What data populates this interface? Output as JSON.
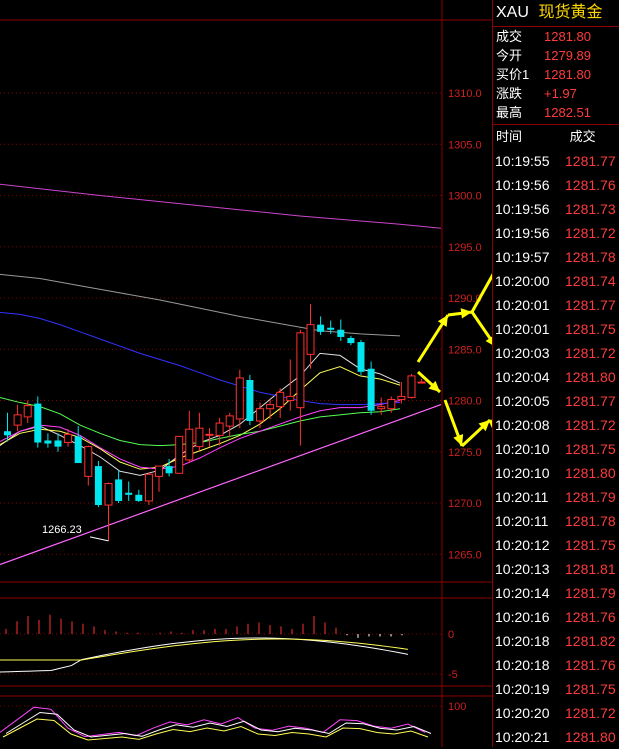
{
  "chart_data": [
    {
      "type": "candlestick",
      "title": "",
      "y_axis_ticks": [
        "1310.0",
        "1305.0",
        "1300.0",
        "1295.0",
        "1290.0",
        "1285.0",
        "1280.0",
        "1275.0",
        "1270.0",
        "1265.0"
      ],
      "ylim": [
        1262.5,
        1313
      ],
      "low_annotation": "1266.23",
      "candles": [
        {
          "o": 1277.0,
          "h": 1278.8,
          "l": 1276.0,
          "c": 1276.6
        },
        {
          "o": 1277.6,
          "h": 1279.6,
          "l": 1277.0,
          "c": 1278.6
        },
        {
          "o": 1278.4,
          "h": 1280.0,
          "l": 1277.8,
          "c": 1279.5
        },
        {
          "o": 1279.7,
          "h": 1280.4,
          "l": 1275.4,
          "c": 1275.9
        },
        {
          "o": 1276.1,
          "h": 1276.8,
          "l": 1275.4,
          "c": 1275.8
        },
        {
          "o": 1276.1,
          "h": 1276.8,
          "l": 1275.0,
          "c": 1275.5
        },
        {
          "o": 1275.9,
          "h": 1277.2,
          "l": 1275.5,
          "c": 1276.7
        },
        {
          "o": 1276.5,
          "h": 1277.5,
          "l": 1273.9,
          "c": 1273.9
        },
        {
          "o": 1272.6,
          "h": 1275.6,
          "l": 1271.7,
          "c": 1275.5
        },
        {
          "o": 1273.6,
          "h": 1274.1,
          "l": 1269.6,
          "c": 1269.8
        },
        {
          "o": 1269.8,
          "h": 1272.0,
          "l": 1266.3,
          "c": 1271.9
        },
        {
          "o": 1272.3,
          "h": 1273.2,
          "l": 1270.0,
          "c": 1270.2
        },
        {
          "o": 1271.0,
          "h": 1272.1,
          "l": 1270.2,
          "c": 1270.8
        },
        {
          "o": 1270.8,
          "h": 1271.3,
          "l": 1270.1,
          "c": 1270.2
        },
        {
          "o": 1270.2,
          "h": 1273.0,
          "l": 1269.8,
          "c": 1272.8
        },
        {
          "o": 1272.6,
          "h": 1273.6,
          "l": 1271.1,
          "c": 1273.6
        },
        {
          "o": 1273.6,
          "h": 1274.3,
          "l": 1272.6,
          "c": 1272.9
        },
        {
          "o": 1272.9,
          "h": 1276.5,
          "l": 1272.9,
          "c": 1276.5
        },
        {
          "o": 1274.2,
          "h": 1279.0,
          "l": 1273.9,
          "c": 1277.2
        },
        {
          "o": 1275.5,
          "h": 1278.8,
          "l": 1275.1,
          "c": 1277.3
        },
        {
          "o": 1276.7,
          "h": 1277.3,
          "l": 1275.5,
          "c": 1276.7
        },
        {
          "o": 1276.6,
          "h": 1278.3,
          "l": 1275.6,
          "c": 1277.8
        },
        {
          "o": 1277.5,
          "h": 1278.8,
          "l": 1276.4,
          "c": 1278.5
        },
        {
          "o": 1278.2,
          "h": 1283.0,
          "l": 1277.3,
          "c": 1282.2
        },
        {
          "o": 1282.0,
          "h": 1282.5,
          "l": 1277.6,
          "c": 1278.0
        },
        {
          "o": 1278.0,
          "h": 1279.8,
          "l": 1277.3,
          "c": 1279.2
        },
        {
          "o": 1279.2,
          "h": 1280.1,
          "l": 1278.2,
          "c": 1279.6
        },
        {
          "o": 1279.4,
          "h": 1281.2,
          "l": 1278.3,
          "c": 1280.8
        },
        {
          "o": 1280.0,
          "h": 1284.0,
          "l": 1279.0,
          "c": 1280.4
        },
        {
          "o": 1279.3,
          "h": 1286.9,
          "l": 1275.6,
          "c": 1286.6
        },
        {
          "o": 1284.5,
          "h": 1289.4,
          "l": 1283.1,
          "c": 1287.4
        },
        {
          "o": 1287.4,
          "h": 1288.2,
          "l": 1286.4,
          "c": 1286.7
        },
        {
          "o": 1287.1,
          "h": 1287.8,
          "l": 1286.5,
          "c": 1286.9
        },
        {
          "o": 1286.9,
          "h": 1287.9,
          "l": 1285.8,
          "c": 1286.2
        },
        {
          "o": 1286.1,
          "h": 1286.3,
          "l": 1285.4,
          "c": 1285.6
        },
        {
          "o": 1285.7,
          "h": 1285.9,
          "l": 1282.5,
          "c": 1282.8
        },
        {
          "o": 1283.1,
          "h": 1283.8,
          "l": 1278.6,
          "c": 1279.0
        },
        {
          "o": 1279.2,
          "h": 1280.3,
          "l": 1278.6,
          "c": 1279.4
        },
        {
          "o": 1279.2,
          "h": 1280.4,
          "l": 1278.8,
          "c": 1280.1
        },
        {
          "o": 1280.1,
          "h": 1281.8,
          "l": 1279.7,
          "c": 1280.4
        },
        {
          "o": 1280.3,
          "h": 1282.6,
          "l": 1280.2,
          "c": 1282.4
        },
        {
          "o": 1281.8,
          "h": 1282.1,
          "l": 1281.7,
          "c": 1281.8
        }
      ],
      "overlay_lines": [
        {
          "color": "#e0e0e0",
          "points": [
            [
              0,
              1275.6
            ],
            [
              20,
              1277.0
            ],
            [
              40,
              1277.5
            ],
            [
              60,
              1276.6
            ],
            [
              80,
              1275.6
            ],
            [
              100,
              1274.5
            ],
            [
              120,
              1273.1
            ],
            [
              140,
              1272.7
            ],
            [
              160,
              1273.2
            ],
            [
              180,
              1274.7
            ],
            [
              200,
              1275.9
            ],
            [
              220,
              1276.6
            ],
            [
              240,
              1277.7
            ],
            [
              260,
              1279.3
            ],
            [
              280,
              1280.9
            ],
            [
              300,
              1282.4
            ],
            [
              320,
              1284.6
            ],
            [
              340,
              1284.4
            ],
            [
              360,
              1283.1
            ],
            [
              380,
              1282.6
            ],
            [
              400,
              1281.7
            ]
          ]
        },
        {
          "color": "#ffff55",
          "points": [
            [
              0,
              1275.7
            ],
            [
              20,
              1276.8
            ],
            [
              40,
              1277.2
            ],
            [
              60,
              1277.0
            ],
            [
              80,
              1276.4
            ],
            [
              100,
              1275.3
            ],
            [
              120,
              1274.0
            ],
            [
              140,
              1273.3
            ],
            [
              160,
              1273.5
            ],
            [
              180,
              1274.4
            ],
            [
              200,
              1275.1
            ],
            [
              220,
              1275.8
            ],
            [
              240,
              1276.6
            ],
            [
              260,
              1277.7
            ],
            [
              280,
              1279.2
            ],
            [
              300,
              1281.0
            ],
            [
              320,
              1282.7
            ],
            [
              340,
              1283.3
            ],
            [
              360,
              1282.4
            ],
            [
              380,
              1282.1
            ],
            [
              400,
              1281.5
            ]
          ]
        },
        {
          "color": "#55ff55",
          "points": [
            [
              0,
              1280.3
            ],
            [
              20,
              1279.8
            ],
            [
              40,
              1279.4
            ],
            [
              60,
              1278.7
            ],
            [
              80,
              1277.6
            ],
            [
              100,
              1276.8
            ],
            [
              120,
              1276.1
            ],
            [
              140,
              1275.7
            ],
            [
              160,
              1275.6
            ],
            [
              180,
              1275.7
            ],
            [
              200,
              1275.9
            ],
            [
              220,
              1276.3
            ],
            [
              240,
              1276.7
            ],
            [
              260,
              1277.0
            ],
            [
              280,
              1277.5
            ],
            [
              300,
              1278.0
            ],
            [
              320,
              1278.4
            ],
            [
              340,
              1278.6
            ],
            [
              360,
              1278.8
            ],
            [
              380,
              1278.9
            ],
            [
              400,
              1279.2
            ]
          ]
        },
        {
          "color": "#ff44ff",
          "points": [
            [
              0,
              1276.0
            ],
            [
              20,
              1277.0
            ],
            [
              40,
              1277.6
            ],
            [
              60,
              1277.4
            ],
            [
              80,
              1276.6
            ],
            [
              100,
              1275.4
            ],
            [
              120,
              1274.3
            ],
            [
              140,
              1273.5
            ],
            [
              160,
              1273.3
            ],
            [
              180,
              1273.6
            ],
            [
              200,
              1274.4
            ],
            [
              220,
              1275.4
            ],
            [
              240,
              1276.3
            ],
            [
              260,
              1277.0
            ],
            [
              280,
              1277.7
            ],
            [
              300,
              1278.4
            ],
            [
              320,
              1279.0
            ],
            [
              340,
              1279.3
            ],
            [
              360,
              1279.3
            ],
            [
              380,
              1279.6
            ],
            [
              400,
              1280.0
            ]
          ]
        },
        {
          "color": "#3333ff",
          "points": [
            [
              0,
              1288.6
            ],
            [
              20,
              1288.4
            ],
            [
              40,
              1288.0
            ],
            [
              60,
              1287.4
            ],
            [
              80,
              1286.7
            ],
            [
              100,
              1286.0
            ],
            [
              120,
              1285.3
            ],
            [
              140,
              1284.6
            ],
            [
              160,
              1284.0
            ],
            [
              180,
              1283.4
            ],
            [
              200,
              1282.7
            ],
            [
              220,
              1282.0
            ],
            [
              240,
              1281.4
            ],
            [
              260,
              1280.8
            ],
            [
              280,
              1280.4
            ],
            [
              300,
              1280.0
            ],
            [
              320,
              1279.7
            ],
            [
              340,
              1279.6
            ],
            [
              360,
              1279.6
            ],
            [
              380,
              1279.7
            ],
            [
              400,
              1279.8
            ]
          ]
        },
        {
          "color": "#999999",
          "points": [
            [
              0,
              1292.3
            ],
            [
              40,
              1291.9
            ],
            [
              80,
              1291.2
            ],
            [
              120,
              1290.5
            ],
            [
              160,
              1289.8
            ],
            [
              200,
              1289.0
            ],
            [
              240,
              1288.2
            ],
            [
              280,
              1287.5
            ],
            [
              320,
              1286.8
            ],
            [
              360,
              1286.5
            ],
            [
              400,
              1286.3
            ]
          ]
        },
        {
          "color": "#cc44cc",
          "points": [
            [
              0,
              1301.1
            ],
            [
              100,
              1300.0
            ],
            [
              200,
              1299.0
            ],
            [
              300,
              1298.0
            ],
            [
              400,
              1297.2
            ],
            [
              441,
              1296.8
            ]
          ]
        }
      ],
      "trendline": {
        "color": "#ff66ff",
        "from": [
          0,
          1264.0
        ],
        "to": [
          441,
          1279.6
        ]
      }
    },
    {
      "type": "bar",
      "y_axis_ticks": [
        "0",
        "-5"
      ],
      "series": [
        {
          "values": [
            0.4,
            1.0,
            1.4,
            1.1,
            1.5,
            1.2,
            1.0,
            0.8,
            0.6,
            0.3,
            0.2,
            0.1,
            0.1,
            0.0,
            0.1,
            0.2,
            0.1,
            0.3,
            0.3,
            0.4,
            0.4,
            0.6,
            0.8,
            0.9,
            0.7,
            0.6,
            0.4,
            0.8,
            1.4,
            0.9,
            0.5,
            -0.1,
            -0.3,
            -0.2,
            -0.2,
            -0.2,
            -0.1
          ]
        }
      ]
    },
    {
      "type": "line",
      "y_axis_ticks": [
        "100"
      ],
      "series": [
        {
          "values": [
            30,
            60,
            90,
            85,
            40,
            20,
            25,
            30,
            22,
            40,
            55,
            48,
            60,
            50,
            65,
            40,
            35,
            45,
            40,
            30,
            60,
            58,
            45,
            40,
            50,
            30
          ]
        }
      ]
    }
  ],
  "quote": {
    "symbol": "XAU",
    "name": "现货黄金",
    "rows": [
      {
        "label": "成交",
        "value": "1281.80"
      },
      {
        "label": "今开",
        "value": "1279.89"
      },
      {
        "label": "买价1",
        "value": "1281.80"
      },
      {
        "label": "涨跌",
        "value": "+1.97"
      },
      {
        "label": "最高",
        "value": "1282.51"
      }
    ],
    "ticks_header": {
      "time": "时间",
      "price": "成交"
    },
    "ticks": [
      {
        "time": "10:19:55",
        "price": "1281.77"
      },
      {
        "time": "10:19:56",
        "price": "1281.76"
      },
      {
        "time": "10:19:56",
        "price": "1281.73"
      },
      {
        "time": "10:19:56",
        "price": "1281.72"
      },
      {
        "time": "10:19:57",
        "price": "1281.78"
      },
      {
        "time": "10:20:00",
        "price": "1281.74"
      },
      {
        "time": "10:20:01",
        "price": "1281.77"
      },
      {
        "time": "10:20:01",
        "price": "1281.75"
      },
      {
        "time": "10:20:03",
        "price": "1281.72"
      },
      {
        "time": "10:20:04",
        "price": "1281.80"
      },
      {
        "time": "10:20:05",
        "price": "1281.77"
      },
      {
        "time": "10:20:08",
        "price": "1281.72"
      },
      {
        "time": "10:20:10",
        "price": "1281.75"
      },
      {
        "time": "10:20:10",
        "price": "1281.80"
      },
      {
        "time": "10:20:11",
        "price": "1281.79"
      },
      {
        "time": "10:20:11",
        "price": "1281.78"
      },
      {
        "time": "10:20:12",
        "price": "1281.75"
      },
      {
        "time": "10:20:13",
        "price": "1281.81"
      },
      {
        "time": "10:20:14",
        "price": "1281.79"
      },
      {
        "time": "10:20:16",
        "price": "1281.76"
      },
      {
        "time": "10:20:18",
        "price": "1281.82"
      },
      {
        "time": "10:20:18",
        "price": "1281.76"
      },
      {
        "time": "10:20:19",
        "price": "1281.75"
      },
      {
        "time": "10:20:20",
        "price": "1281.72"
      },
      {
        "time": "10:20:21",
        "price": "1281.80"
      }
    ]
  },
  "colors": {
    "up": "#ff3030",
    "down": "#00e5ee",
    "grid": "#8b0000",
    "axis_text": "#cc2020",
    "arrow": "#ffff00"
  }
}
